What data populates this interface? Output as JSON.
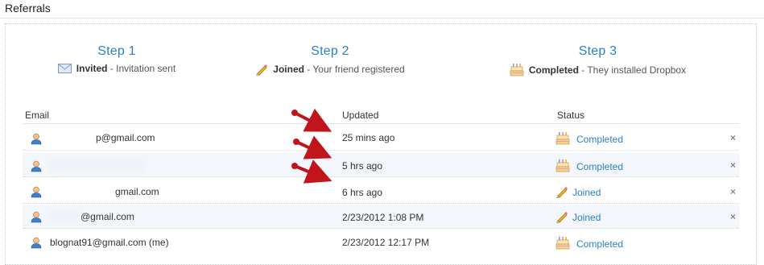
{
  "section": {
    "title": "Referrals"
  },
  "steps": [
    {
      "title": "Step 1",
      "strong": "Invited",
      "desc": " - Invitation sent",
      "icon": "envelope-icon"
    },
    {
      "title": "Step 2",
      "strong": "Joined",
      "desc": " - Your friend registered",
      "icon": "pencil-icon"
    },
    {
      "title": "Step 3",
      "strong": "Completed",
      "desc": " - They installed Dropbox",
      "icon": "cake-icon"
    }
  ],
  "table": {
    "columns": {
      "email": "Email",
      "updated": "Updated",
      "status": "Status"
    },
    "remove_glyph": "×",
    "rows": [
      {
        "email": "p@gmail.com",
        "updated": "25 mins ago",
        "status": "Completed",
        "status_icon": "cake-icon"
      },
      {
        "email": "",
        "updated": "5 hrs ago",
        "status": "Completed",
        "status_icon": "cake-icon"
      },
      {
        "email": "gmail.com",
        "updated": "6 hrs ago",
        "status": "Joined",
        "status_icon": "pencil-icon"
      },
      {
        "email": "@gmail.com",
        "updated": "2/23/2012 1:08 PM",
        "status": "Joined",
        "status_icon": "pencil-icon"
      },
      {
        "email": "blognat91@gmail.com (me)",
        "updated": "2/23/2012 12:17 PM",
        "status": "Completed",
        "status_icon": "cake-icon"
      }
    ]
  },
  "colors": {
    "link": "#2a7fc9",
    "arrow": "#c0161b"
  }
}
